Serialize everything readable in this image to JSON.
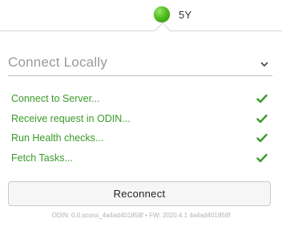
{
  "header": {
    "status_label": "5Y",
    "status_color": "#4fbf1f"
  },
  "connect": {
    "mode_label": "Connect Locally",
    "steps": [
      {
        "label": "Connect to Server...",
        "icon": "checkmark-icon"
      },
      {
        "label": "Receive request in ODIN...",
        "icon": "checkmark-icon"
      },
      {
        "label": "Run Health checks...",
        "icon": "checkmark-icon"
      },
      {
        "label": "Fetch Tasks...",
        "icon": "checkmark-icon"
      }
    ],
    "reconnect_label": "Reconnect",
    "footer_text": "ODIN: 0.0.scons_4a4ad401858f • FW: 2020.4.1 4a4ad401858f",
    "success_color": "#3a9a2a"
  }
}
